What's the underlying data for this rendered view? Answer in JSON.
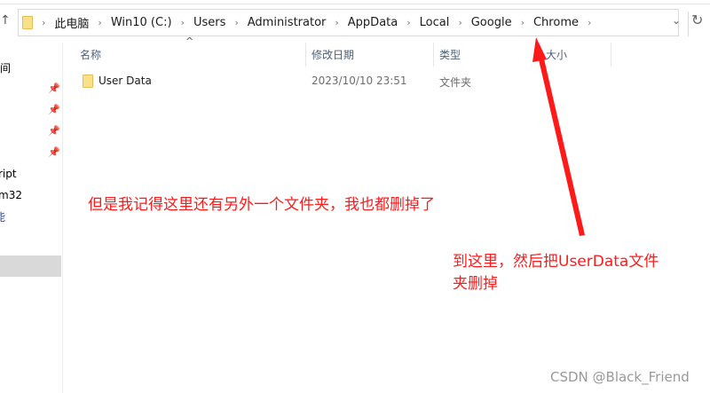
{
  "address": {
    "crumbs": [
      "此电脑",
      "Win10 (C:)",
      "Users",
      "Administrator",
      "AppData",
      "Local",
      "Google",
      "Chrome"
    ]
  },
  "nav": {
    "items": [
      "间",
      "ript",
      "m32",
      "能"
    ]
  },
  "columns": {
    "name": "名称",
    "modified": "修改日期",
    "type": "类型",
    "size": "大小"
  },
  "files": [
    {
      "name": "User Data",
      "modified": "2023/10/10 23:51",
      "type": "文件夹",
      "size": ""
    }
  ],
  "annotations": {
    "note1": "但是我记得这里还有另外一个文件夹，我也都删掉了",
    "note2_line1": "到这里，然后把UserData文件",
    "note2_line2": "夹删掉",
    "arrow_color": "#ff1a1a"
  },
  "watermark": "CSDN @Black_Friend"
}
